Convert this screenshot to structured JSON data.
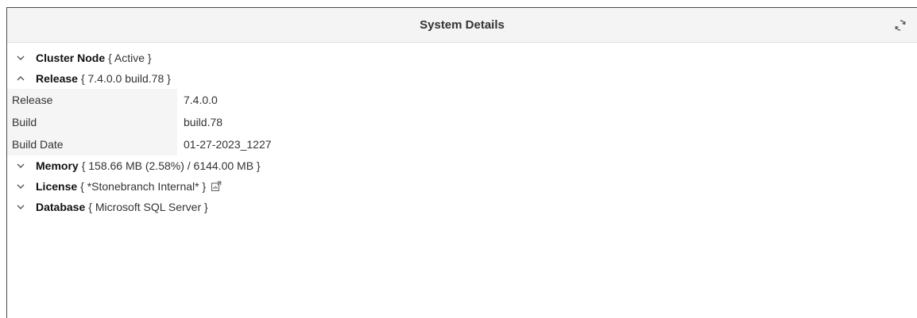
{
  "panel": {
    "title": "System Details",
    "refresh_icon": "refresh-icon"
  },
  "sections": {
    "cluster": {
      "name": "Cluster Node",
      "value": "{ Active }",
      "state": "collapsed"
    },
    "release": {
      "name": "Release",
      "value": "{ 7.4.0.0 build.78 }",
      "state": "expanded",
      "rows": [
        {
          "key": "Release",
          "value": "7.4.0.0"
        },
        {
          "key": "Build",
          "value": "build.78"
        },
        {
          "key": "Build Date",
          "value": "01-27-2023_1227"
        }
      ]
    },
    "memory": {
      "name": "Memory",
      "value": "{ 158.66 MB (2.58%) / 6144.00 MB }",
      "state": "collapsed"
    },
    "license": {
      "name": "License",
      "value": "{ *Stonebranch Internal* }",
      "state": "collapsed",
      "link_icon": "external-link-icon"
    },
    "database": {
      "name": "Database",
      "value": "{ Microsoft SQL Server }",
      "state": "collapsed"
    }
  }
}
